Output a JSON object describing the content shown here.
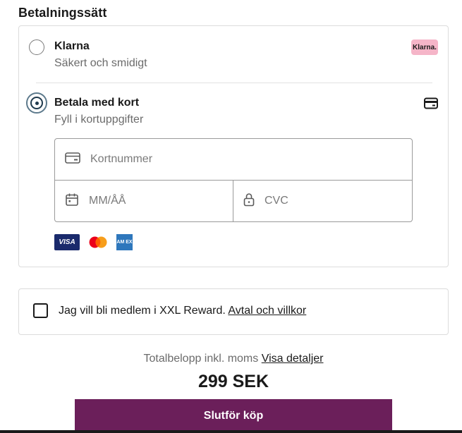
{
  "payment": {
    "section_title": "Betalningssätt",
    "options": [
      {
        "title": "Klarna",
        "subtitle": "Säkert och smidigt",
        "badge": "Klarna.",
        "selected": false
      },
      {
        "title": "Betala med kort",
        "subtitle": "Fyll i kortuppgifter",
        "icon": "credit-card-icon",
        "selected": true
      }
    ],
    "card_form": {
      "number_placeholder": "Kortnummer",
      "expiry_placeholder": "MM/ÅÅ",
      "cvc_placeholder": "CVC"
    },
    "brands": {
      "visa": "VISA",
      "amex": "AM EX"
    }
  },
  "reward": {
    "text": "Jag vill bli medlem i XXL Reward.",
    "link": "Avtal och villkor"
  },
  "total": {
    "label": "Totalbelopp inkl. moms",
    "details_link": "Visa detaljer",
    "amount": "299 SEK"
  },
  "submit": {
    "label": "Slutför köp"
  },
  "colors": {
    "button": "#6b1f5a",
    "klarna_badge": "#f5b5c8"
  }
}
